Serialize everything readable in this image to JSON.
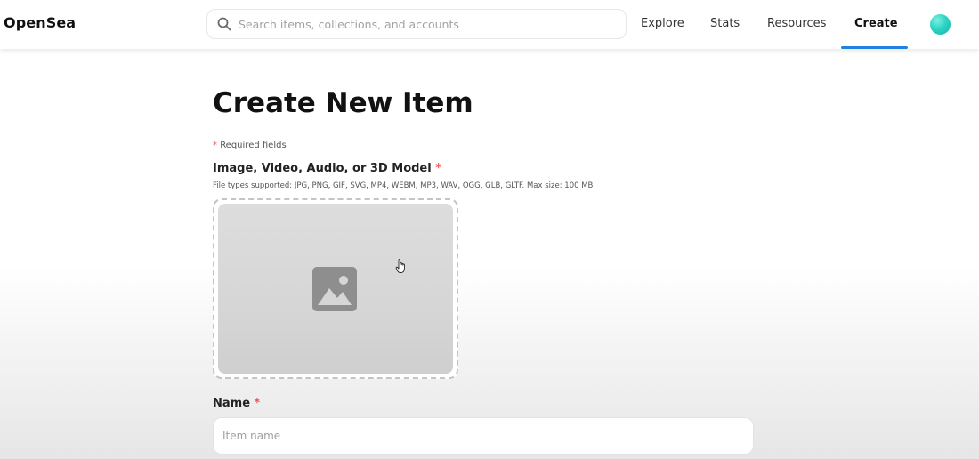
{
  "header": {
    "logo": "OpenSea",
    "search": {
      "placeholder": "Search items, collections, and accounts",
      "value": ""
    },
    "nav": [
      {
        "label": "Explore",
        "active": false
      },
      {
        "label": "Stats",
        "active": false
      },
      {
        "label": "Resources",
        "active": false
      },
      {
        "label": "Create",
        "active": true
      }
    ],
    "accent_color": "#2081e2",
    "avatar_color": "#2fd3c4"
  },
  "main": {
    "title": "Create New Item",
    "required_marker": "*",
    "required_note": "Required fields",
    "media": {
      "label": "Image, Video, Audio, or 3D Model",
      "supported": "File types supported: JPG, PNG, GIF, SVG, MP4, WEBM, MP3, WAV, OGG, GLB, GLTF. Max size: 100 MB",
      "icon": "image-icon"
    },
    "name_field": {
      "label": "Name",
      "placeholder": "Item name",
      "value": ""
    },
    "required_color": "#eb5757"
  }
}
